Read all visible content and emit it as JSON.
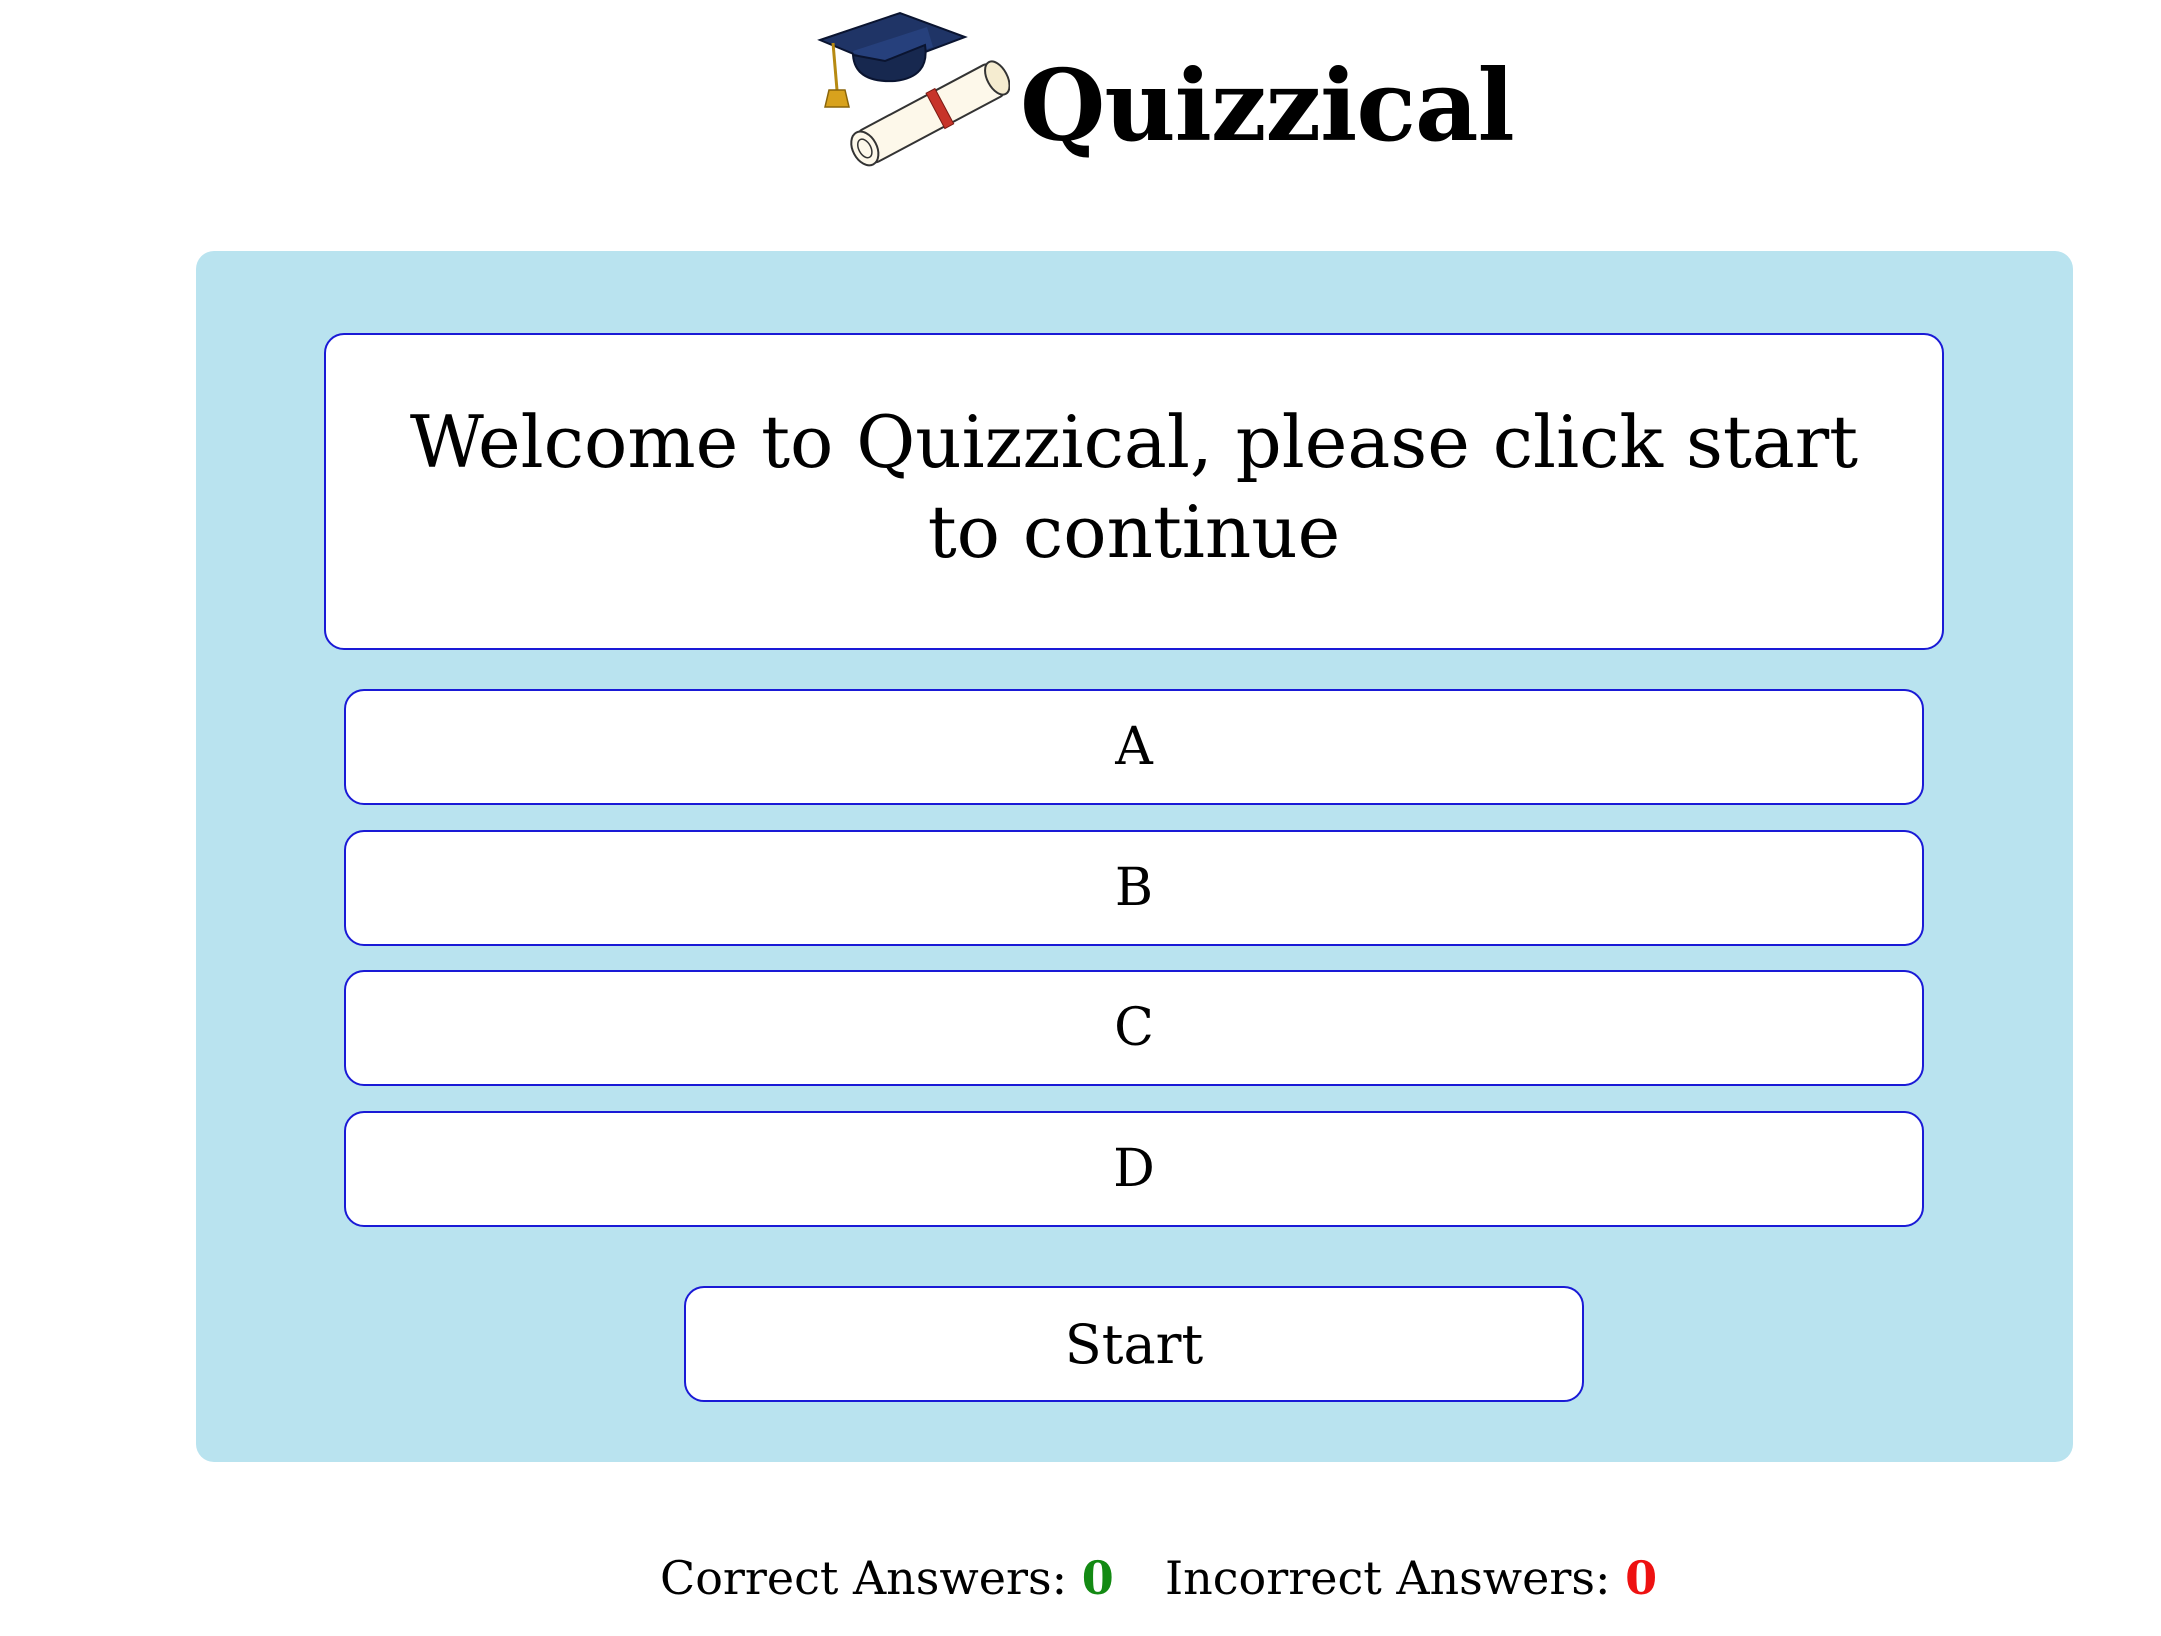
{
  "header": {
    "title": "Quizzical",
    "logo_icon": "graduation-cap-diploma-icon"
  },
  "quiz": {
    "question": "Welcome to Quizzical, please click start to continue",
    "answers": [
      "A",
      "B",
      "C",
      "D"
    ],
    "start_label": "Start"
  },
  "score": {
    "correct_label": "Correct Answers:",
    "correct_value": "0",
    "incorrect_label": "Incorrect Answers:",
    "incorrect_value": "0"
  },
  "colors": {
    "panel_background": "#b9e3ef",
    "button_border": "#1a1ad6",
    "correct_color": "#138a13",
    "incorrect_color": "#ee1111"
  }
}
